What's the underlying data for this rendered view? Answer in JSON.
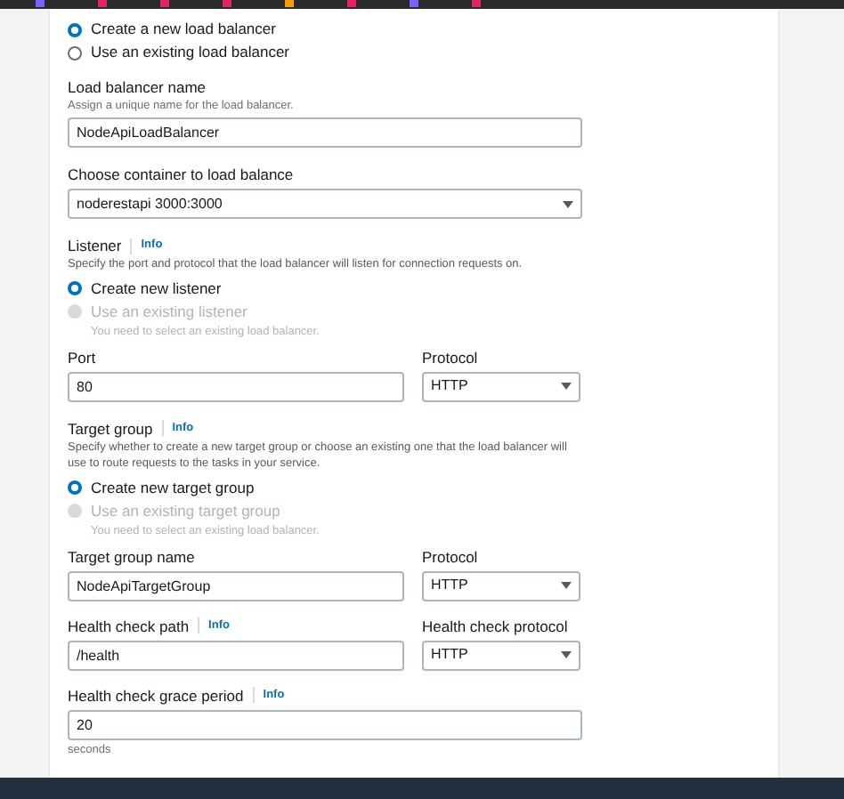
{
  "blocks": [
    {
      "kind": "radios",
      "options": [
        {
          "label": "Create a new load balancer",
          "selected": true,
          "disabled": false
        },
        {
          "label": "Use an existing load balancer",
          "selected": false,
          "disabled": false
        }
      ]
    },
    {
      "kind": "input_field",
      "label": "Load balancer name",
      "hint": "Assign a unique name for the load balancer.",
      "value": "NodeApiLoadBalancer"
    },
    {
      "kind": "select_field",
      "label": "Choose container to load balance",
      "value": "noderestapi 3000:3000"
    },
    {
      "kind": "heading",
      "label": "Listener",
      "info": "Info",
      "description": "Specify the port and protocol that the load balancer will listen for connection requests on."
    },
    {
      "kind": "radios",
      "options": [
        {
          "label": "Create new listener",
          "selected": true,
          "disabled": false
        },
        {
          "label": "Use an existing listener",
          "selected": false,
          "disabled": true,
          "hint": "You need to select an existing load balancer."
        }
      ]
    },
    {
      "kind": "pair",
      "fields": [
        {
          "kind": "input_field",
          "label": "Port",
          "value": "80"
        },
        {
          "kind": "select_field",
          "label": "Protocol",
          "value": "HTTP"
        }
      ]
    },
    {
      "kind": "heading",
      "label": "Target group",
      "info": "Info",
      "description": "Specify whether to create a new target group or choose an existing one that the load balancer will use to route requests to the tasks in your service."
    },
    {
      "kind": "radios",
      "options": [
        {
          "label": "Create new target group",
          "selected": true,
          "disabled": false
        },
        {
          "label": "Use an existing target group",
          "selected": false,
          "disabled": true,
          "hint": "You need to select an existing load balancer."
        }
      ]
    },
    {
      "kind": "pair",
      "fields": [
        {
          "kind": "input_field",
          "label": "Target group name",
          "value": "NodeApiTargetGroup"
        },
        {
          "kind": "select_field",
          "label": "Protocol",
          "value": "HTTP"
        }
      ]
    },
    {
      "kind": "pair",
      "fields": [
        {
          "kind": "input_field",
          "label": "Health check path",
          "info": "Info",
          "value": "/health"
        },
        {
          "kind": "select_field",
          "label": "Health check protocol",
          "value": "HTTP"
        }
      ]
    },
    {
      "kind": "input_field",
      "label": "Health check grace period",
      "info": "Info",
      "value": "20",
      "suffix": "seconds"
    }
  ]
}
